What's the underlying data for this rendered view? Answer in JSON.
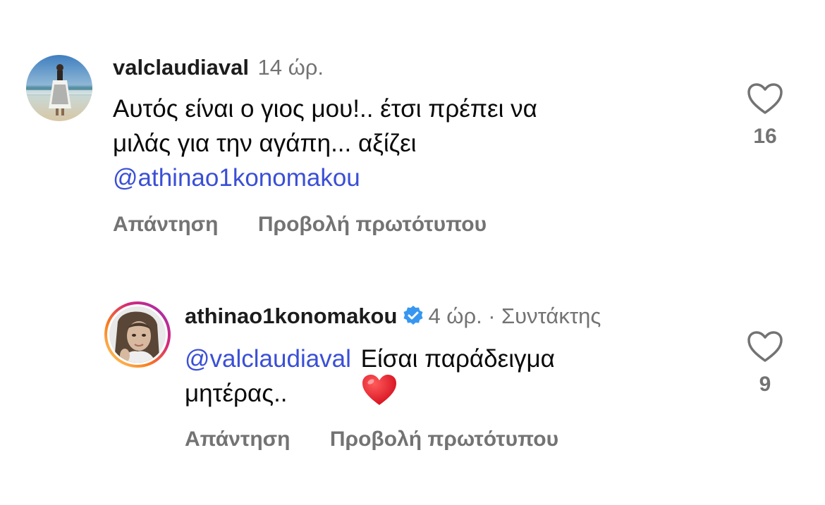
{
  "comments": [
    {
      "username": "valclaudiaval",
      "time": "14 ώρ.",
      "text_line1": "Αυτός είναι ο γιος μου!.. έτσι πρέπει να",
      "text_line2": "μιλάς για την αγάπη... αξίζει",
      "mention": "@athinao1konomakou",
      "reply_label": "Απάντηση",
      "view_original_label": "Προβολή πρωτότυπου",
      "likes": "16",
      "like_icon": "heart-outline-icon"
    },
    {
      "username": "athinao1konomakou",
      "verified": true,
      "time": "4 ώρ.",
      "separator": "·",
      "role": "Συντάκτης",
      "mention": "@valclaudiaval",
      "text_line1": "Είσαι παράδειγμα",
      "text_line2": "μητέρας..",
      "emoji": "❤️",
      "reply_label": "Απάντηση",
      "view_original_label": "Προβολή πρωτότυπου",
      "likes": "9",
      "like_icon": "heart-outline-icon"
    }
  ],
  "colors": {
    "mention": "#3a4fd6",
    "secondary": "#737373",
    "verified": "#3797f0"
  }
}
